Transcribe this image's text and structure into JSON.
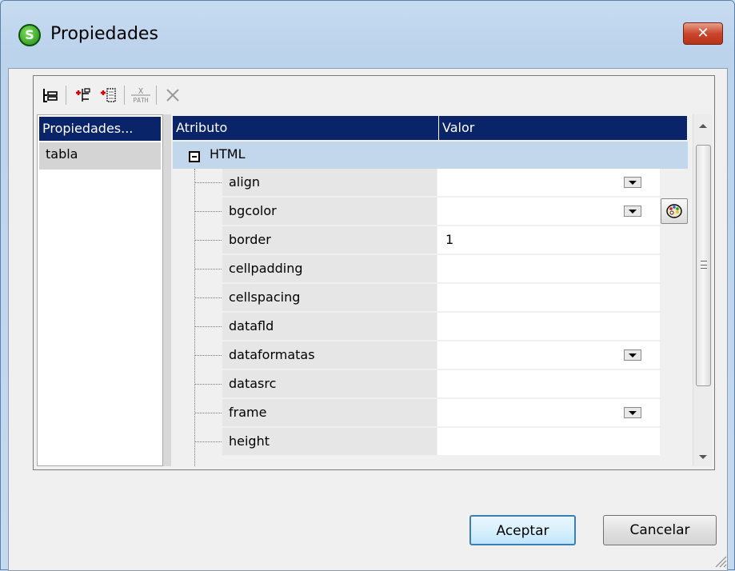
{
  "window": {
    "title": "Propiedades",
    "app_icon_letter": "S",
    "close_symbol": "✕"
  },
  "toolbar": {
    "buttons": [
      {
        "name": "tree-view-icon"
      },
      {
        "name": "insert-before-icon"
      },
      {
        "name": "insert-after-icon"
      },
      {
        "name": "xpath-icon",
        "label": "PATH"
      },
      {
        "name": "delete-icon"
      }
    ]
  },
  "left_pane": {
    "header": "Propiedades...",
    "items": [
      "tabla"
    ]
  },
  "grid": {
    "columns": [
      "Atributo",
      "Valor"
    ],
    "group": "HTML",
    "rows": [
      {
        "name": "align",
        "value": "",
        "dropdown": true,
        "palette": false
      },
      {
        "name": "bgcolor",
        "value": "",
        "dropdown": true,
        "palette": true
      },
      {
        "name": "border",
        "value": "1",
        "dropdown": false,
        "palette": false
      },
      {
        "name": "cellpadding",
        "value": "",
        "dropdown": false,
        "palette": false
      },
      {
        "name": "cellspacing",
        "value": "",
        "dropdown": false,
        "palette": false
      },
      {
        "name": "datafld",
        "value": "",
        "dropdown": false,
        "palette": false
      },
      {
        "name": "dataformatas",
        "value": "",
        "dropdown": true,
        "palette": false
      },
      {
        "name": "datasrc",
        "value": "",
        "dropdown": false,
        "palette": false
      },
      {
        "name": "frame",
        "value": "",
        "dropdown": true,
        "palette": false
      },
      {
        "name": "height",
        "value": "",
        "dropdown": false,
        "palette": false
      }
    ]
  },
  "buttons": {
    "ok": "Aceptar",
    "cancel": "Cancelar"
  },
  "colors": {
    "header_bg": "#0a246a",
    "selected_row": "#c3d7ec",
    "close_button": "#c9472d"
  }
}
